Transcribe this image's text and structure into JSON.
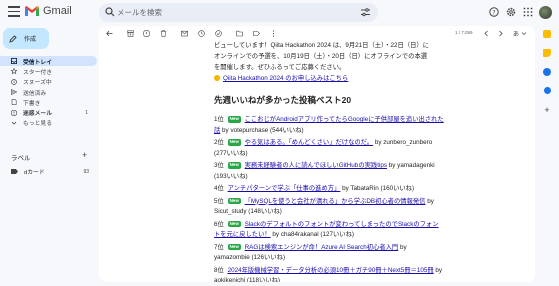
{
  "app": {
    "name": "Gmail"
  },
  "search": {
    "placeholder": "メールを検索"
  },
  "compose_label": "作成",
  "nav": [
    {
      "label": "受信トレイ",
      "count": "",
      "active": true,
      "icon": "inbox-icon"
    },
    {
      "label": "スター付き",
      "count": "",
      "active": false,
      "icon": "star-icon"
    },
    {
      "label": "スヌーズ中",
      "count": "",
      "active": false,
      "icon": "clock-icon"
    },
    {
      "label": "送信済み",
      "count": "",
      "active": false,
      "icon": "send-icon"
    },
    {
      "label": "下書き",
      "count": "",
      "active": false,
      "icon": "draft-icon"
    },
    {
      "label": "迷惑メール",
      "count": "1",
      "active": false,
      "bold": true,
      "icon": "spam-icon"
    },
    {
      "label": "もっと見る",
      "count": "",
      "active": false,
      "icon": "chevron-down-icon"
    }
  ],
  "labels": {
    "heading": "ラベル",
    "items": [
      {
        "name": "dカード",
        "count": "93"
      }
    ]
  },
  "toolbar": {
    "pagination": "1 / 7,059"
  },
  "email": {
    "intro_line1": "ビューしています！Qiita Hackathon 2024 は、9月21日（土）・22日（日）に",
    "intro_line2": "オンラインでの予選を、10月19日（土）・20日（日）にオフラインでの本選",
    "intro_line3": "を開催します。ぜひふるってご応募ください。",
    "intro_link": "Qiita Hackathon 2024 のお申し込みはこちら",
    "section_title": "先週いいねが多かった投稿ベスト20",
    "posts": [
      {
        "rank": "1位",
        "new": true,
        "title": "ここおじがAndroidアプリ作ってたらGoogleに子供部屋を追い出された話",
        "by": "by votepurchase (544いいね)"
      },
      {
        "rank": "2位",
        "new": true,
        "title": "やる気はある。「めんどくさい」だけなのだ。",
        "by": "by zunbero_zunbero (277いいね)"
      },
      {
        "rank": "3位",
        "new": true,
        "title": "実務未経験者の人に読んでほしいGitHubの実践tips",
        "by": "by yamadagenki (193いいね)"
      },
      {
        "rank": "4位",
        "new": false,
        "title": "アンチパターンで学ぶ「仕事の進め方」",
        "by": "by TabataRin (160いいね)"
      },
      {
        "rank": "5位",
        "new": true,
        "title": "「MySQLを使うと会社が潰れる」から学ぶDB初心者の情報発信",
        "by": "by Sicut_study (148いいね)"
      },
      {
        "rank": "6位",
        "new": true,
        "title": "Slackのデフォルトのフォントが変わってしまったのでSlackのフォントを元に戻したい！",
        "by": "by cha84rakanal (127いいね)"
      },
      {
        "rank": "7位",
        "new": true,
        "title": "RAGは検索エンジンが命！Azure AI Search初心者入門",
        "by": "by yamazombie (126いいね)"
      },
      {
        "rank": "8位",
        "new": false,
        "title": "2024年版機械学習・データ分析の必須10冊＋ガチ90冊＋Next5冊＝105冊",
        "by": "by aokikenichi (118いいね)"
      }
    ]
  },
  "colors": {
    "accent": "#c2e7ff",
    "active_nav": "#d3e3fd",
    "new_badge": "#28a745",
    "link": "#1a0dab"
  }
}
